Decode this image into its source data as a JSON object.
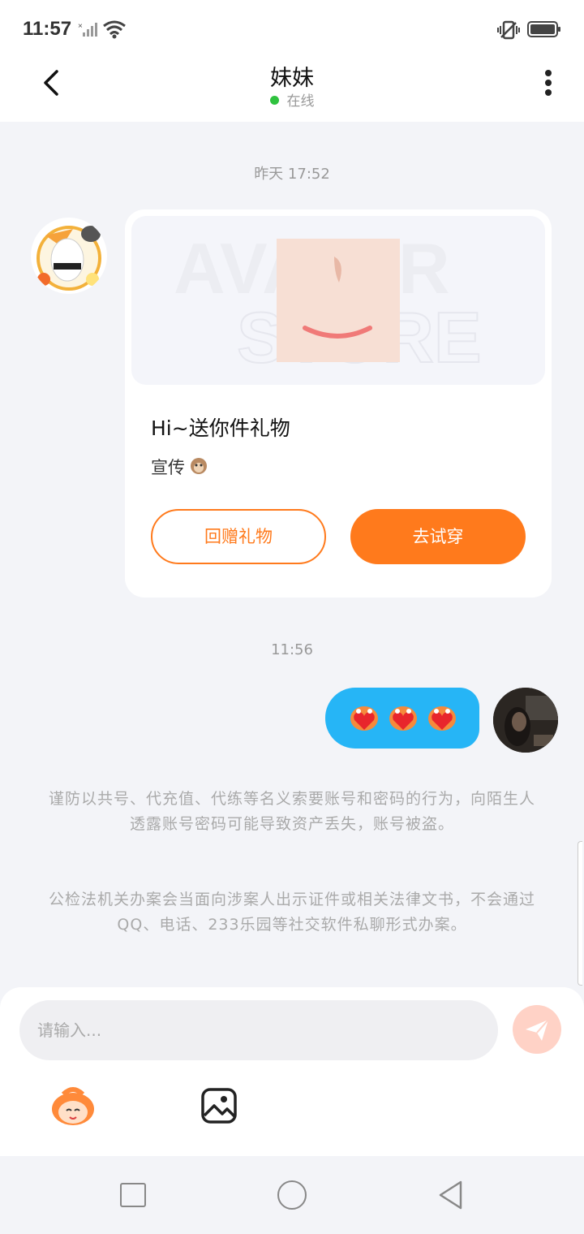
{
  "status_bar": {
    "time": "11:57"
  },
  "header": {
    "title": "妹妹",
    "status": "在线"
  },
  "messages": {
    "timestamp_1": "昨天 17:52",
    "gift": {
      "title": "Hi~送你件礼物",
      "subtitle": "宣传",
      "return_button": "回赠礼物",
      "try_button": "去试穿",
      "watermark": "AVATAR STORE"
    },
    "timestamp_2": "11:56"
  },
  "warnings": {
    "line_1": "谨防以共号、代充值、代练等名义索要账号和密码的行为，向陌生人透露账号密码可能导致资产丢失，账号被盗。",
    "line_2": "公检法机关办案会当面向涉案人出示证件或相关法律文书，不会通过QQ、电话、233乐园等社交软件私聊形式办案。"
  },
  "composer": {
    "placeholder": "请输入..."
  },
  "colors": {
    "accent": "#ff7a1c",
    "bubble": "#26b5f6",
    "online": "#2fc23f"
  },
  "icons": [
    "back-arrow-icon",
    "more-vert-icon",
    "send-icon",
    "emoji-icon",
    "image-icon"
  ]
}
